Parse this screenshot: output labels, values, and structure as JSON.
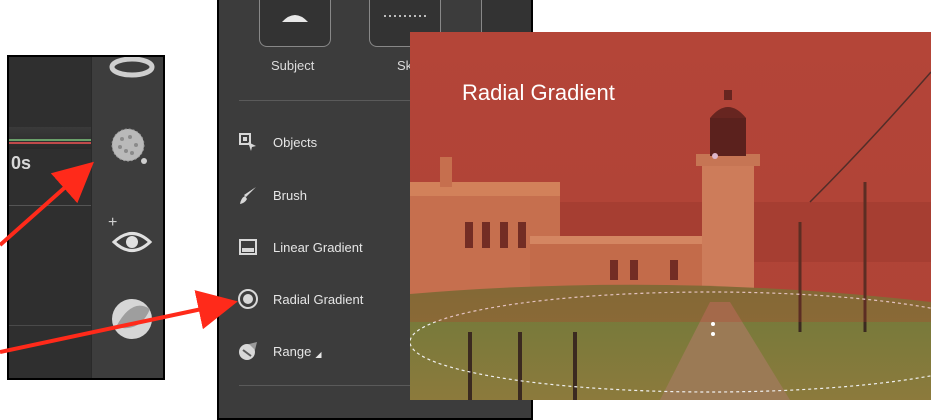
{
  "left_panel": {
    "partial_text": "0s"
  },
  "mask_panel": {
    "tiles": [
      {
        "label": "Subject"
      },
      {
        "label": "Sk"
      }
    ],
    "items": [
      {
        "label": "Objects",
        "icon": "objects-icon"
      },
      {
        "label": "Brush",
        "icon": "brush-icon"
      },
      {
        "label": "Linear Gradient",
        "icon": "linear-gradient-icon"
      },
      {
        "label": "Radial Gradient",
        "icon": "radial-gradient-icon"
      },
      {
        "label": "Range",
        "icon": "range-icon",
        "submenu_glyph": "◢"
      }
    ]
  },
  "photo": {
    "caption": "Radial Gradient"
  },
  "colors": {
    "arrow": "#ff2a1a",
    "panel_bg": "#3c3c3c",
    "overlay": "#c0392b"
  }
}
